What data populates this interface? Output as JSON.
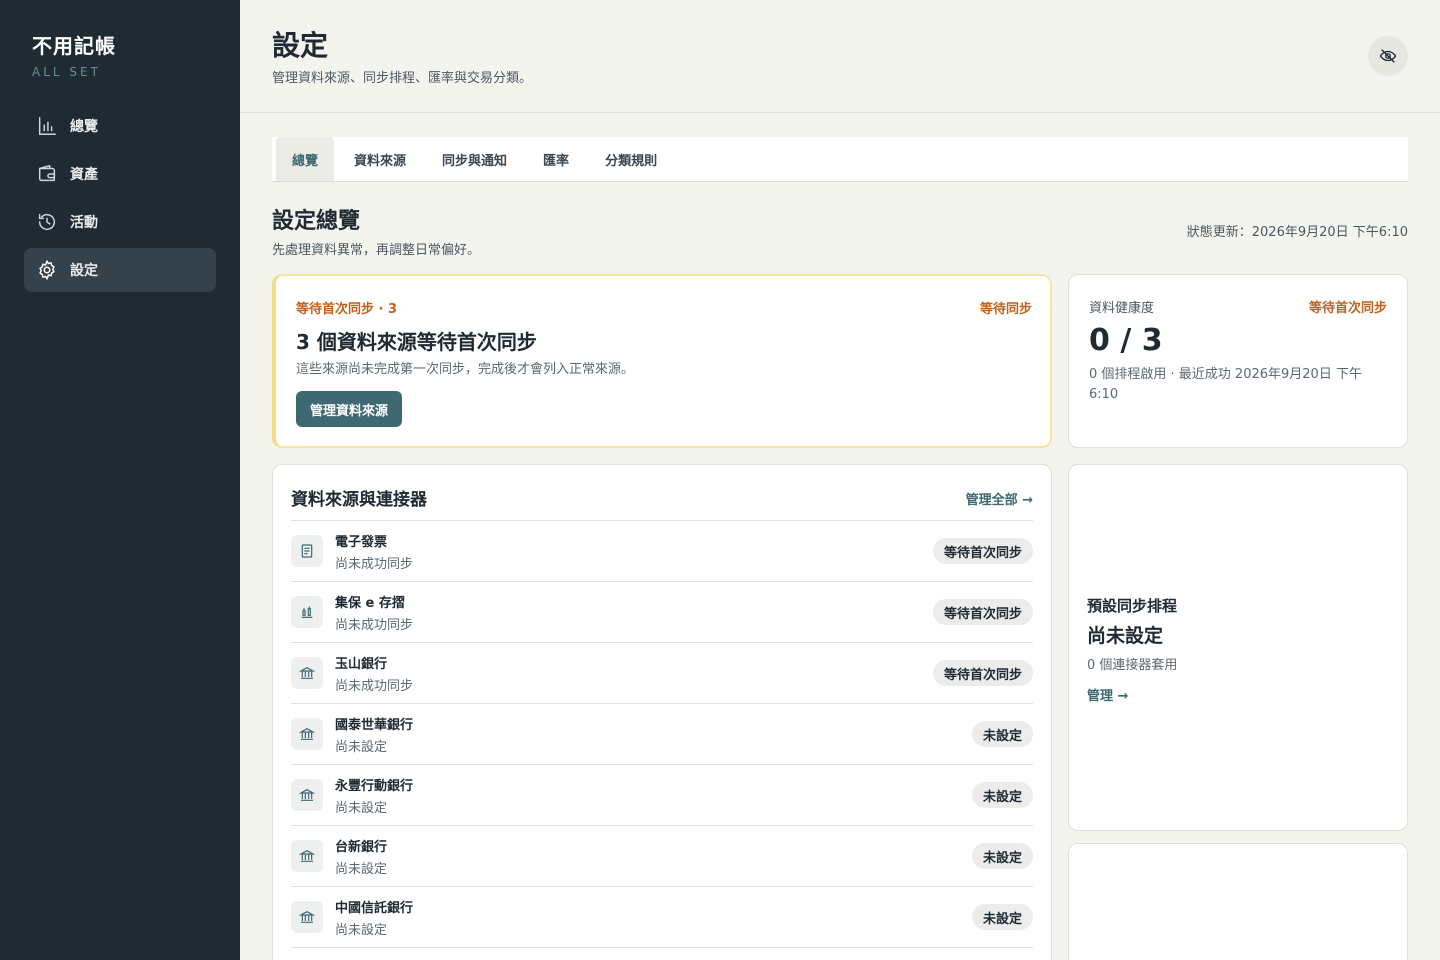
{
  "app": {
    "name": "不用記帳",
    "tagline": "ALL SET"
  },
  "sidebar": {
    "items": [
      {
        "label": "總覽",
        "icon": "bar-chart-icon"
      },
      {
        "label": "資產",
        "icon": "wallet-icon"
      },
      {
        "label": "活動",
        "icon": "history-icon"
      },
      {
        "label": "設定",
        "icon": "gear-icon",
        "active": true
      }
    ]
  },
  "header": {
    "title": "設定",
    "subtitle": "管理資料來源、同步排程、匯率與交易分類。",
    "toggle_icon": "eye-off-icon"
  },
  "tabs": [
    {
      "label": "總覽",
      "active": true
    },
    {
      "label": "資料來源"
    },
    {
      "label": "同步與通知"
    },
    {
      "label": "匯率"
    },
    {
      "label": "分類規則"
    }
  ],
  "overview": {
    "title": "設定總覽",
    "subtitle": "先處理資料異常，再調整日常偏好。",
    "status_time": "狀態更新：2026年9月20日 下午6:10"
  },
  "alert": {
    "kicker": "等待首次同步 · 3",
    "status": "等待同步",
    "title": "3 個資料來源等待首次同步",
    "description": "這些來源尚未完成第一次同步，完成後才會列入正常來源。",
    "button": "管理資料來源"
  },
  "health": {
    "label": "資料健康度",
    "status": "等待首次同步",
    "value": "0 / 3",
    "meta": "0 個排程啟用 · 最近成功 2026年9月20日 下午6:10"
  },
  "sources": {
    "title": "資料來源與連接器",
    "link": "管理全部 →",
    "rows": [
      {
        "name": "電子發票",
        "status": "尚未成功同步",
        "badge": "等待首次同步",
        "icon": "receipt-icon"
      },
      {
        "name": "集保 e 存摺",
        "status": "尚未成功同步",
        "badge": "等待首次同步",
        "icon": "stocks-icon"
      },
      {
        "name": "玉山銀行",
        "status": "尚未成功同步",
        "badge": "等待首次同步",
        "icon": "bank-icon"
      },
      {
        "name": "國泰世華銀行",
        "status": "尚未設定",
        "badge": "未設定",
        "icon": "bank-icon"
      },
      {
        "name": "永豐行動銀行",
        "status": "尚未設定",
        "badge": "未設定",
        "icon": "bank-icon"
      },
      {
        "name": "台新銀行",
        "status": "尚未設定",
        "badge": "未設定",
        "icon": "bank-icon"
      },
      {
        "name": "中國信託銀行",
        "status": "尚未設定",
        "badge": "未設定",
        "icon": "bank-icon"
      }
    ]
  },
  "schedule": {
    "label": "預設同步排程",
    "value": "尚未設定",
    "meta": "0 個連接器套用",
    "link": "管理 →"
  },
  "colors": {
    "sidebar_bg": "#1f2a33",
    "accent": "#3e6872",
    "warning": "#c0621e",
    "page_bg": "#f4f4ef"
  }
}
